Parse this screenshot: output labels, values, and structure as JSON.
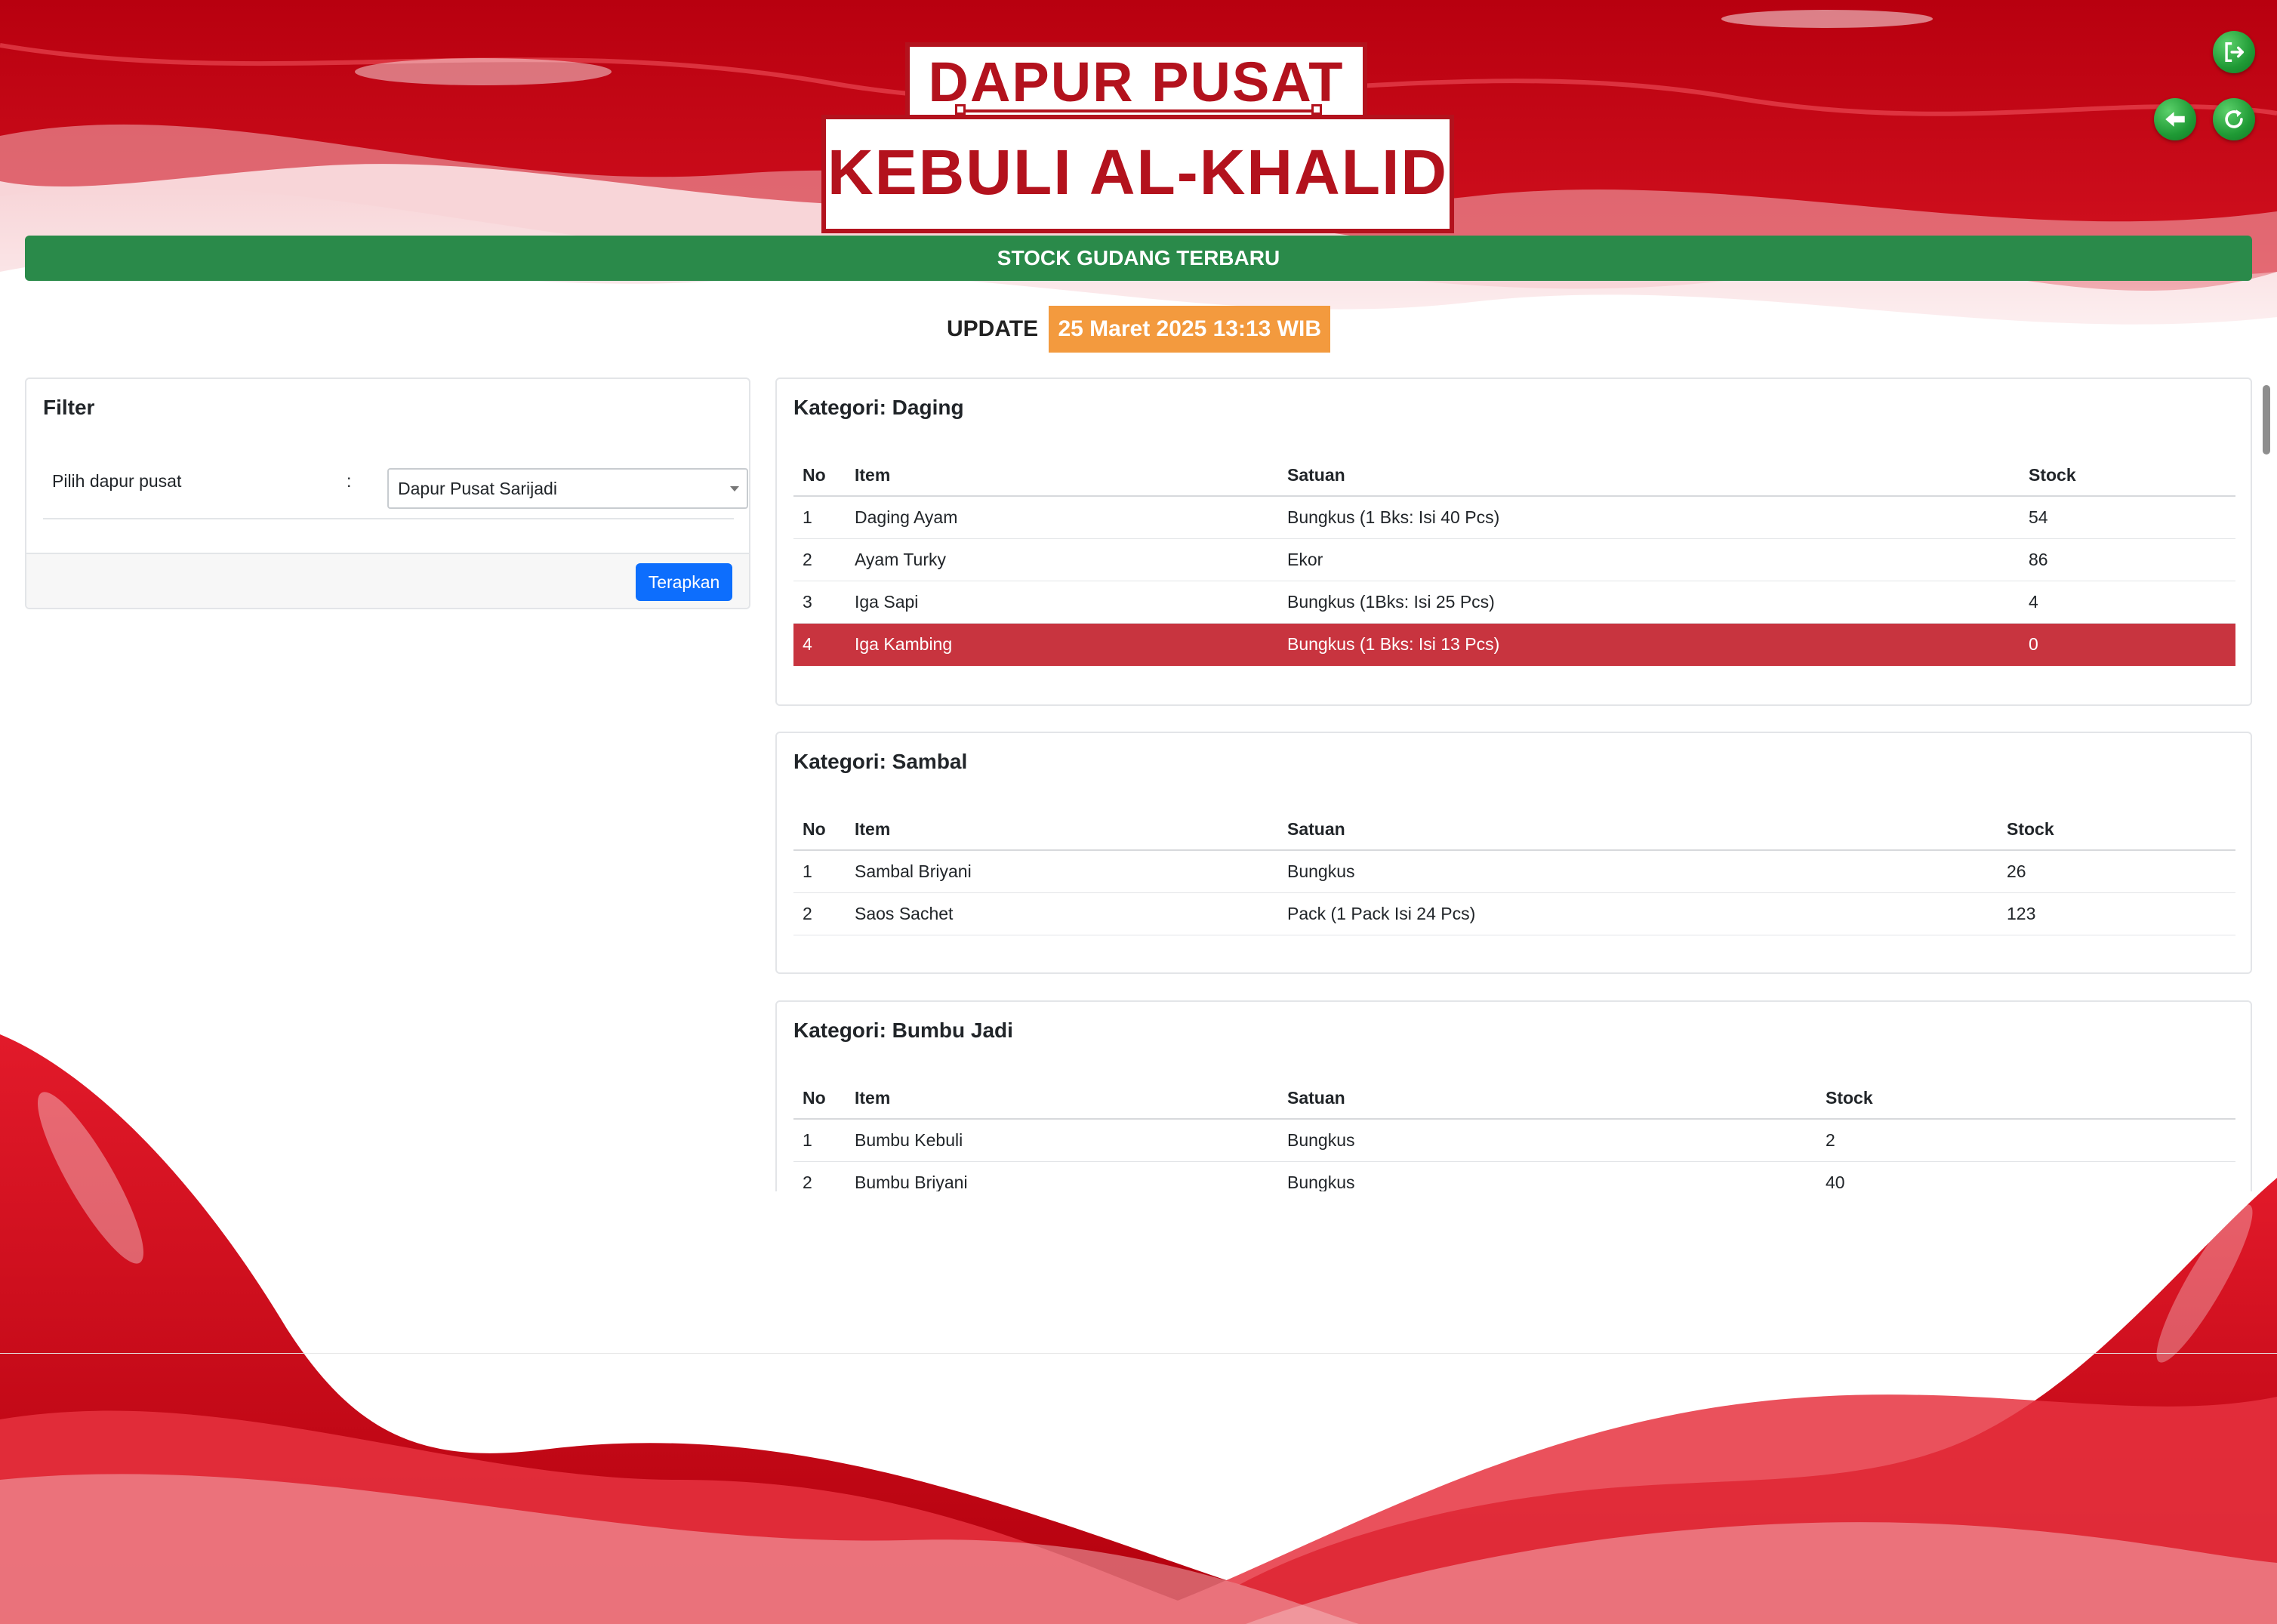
{
  "header": {
    "logo_line1": "DAPUR PUSAT",
    "logo_line2": "KEBULI AL-KHALID",
    "brand_color": "#b3121d"
  },
  "toolbar": {
    "logout_icon": "logout-icon",
    "back_icon": "back-arrow-icon",
    "refresh_icon": "refresh-icon",
    "button_color": "#1f9a35"
  },
  "banner": {
    "title": "STOCK GUDANG TERBARU",
    "color": "#2a8a4a"
  },
  "update": {
    "label": "UPDATE",
    "datetime": "25 Maret 2025 13:13 WIB",
    "highlight_color": "#f39a3e"
  },
  "filter": {
    "title": "Filter",
    "field_label": "Pilih dapur pusat",
    "colon": ":",
    "selected_value": "Dapur Pusat Sarijadi",
    "apply_label": "Terapkan"
  },
  "categories": [
    {
      "title": "Kategori: Daging",
      "headers": [
        "No",
        "Item",
        "Satuan",
        "Stock"
      ],
      "rows": [
        [
          "1",
          "Daging Ayam",
          "Bungkus (1 Bks: Isi 40 Pcs)",
          "54"
        ],
        [
          "2",
          "Ayam Turky",
          "Ekor",
          "86"
        ],
        [
          "3",
          "Iga Sapi",
          "Bungkus (1Bks: Isi 25 Pcs)",
          "4"
        ],
        [
          "4",
          "Iga Kambing",
          "Bungkus (1 Bks: Isi 13 Pcs)",
          "0"
        ]
      ],
      "danger_row": 3
    },
    {
      "title": "Kategori: Sambal",
      "headers": [
        "No",
        "Item",
        "Satuan",
        "Stock"
      ],
      "rows": [
        [
          "1",
          "Sambal Briyani",
          "Bungkus",
          "26"
        ],
        [
          "2",
          "Saos Sachet",
          "Pack (1 Pack Isi 24 Pcs)",
          "123"
        ]
      ]
    },
    {
      "title": "Kategori: Bumbu Jadi",
      "headers": [
        "No",
        "Item",
        "Satuan",
        "Stock"
      ],
      "rows": [
        [
          "1",
          "Bumbu Kebuli",
          "Bungkus",
          "2"
        ],
        [
          "2",
          "Bumbu Briyani",
          "Bungkus",
          "40"
        ]
      ]
    }
  ],
  "colors": {
    "danger_row": "#c8343f",
    "apply_button": "#0d6efd"
  }
}
